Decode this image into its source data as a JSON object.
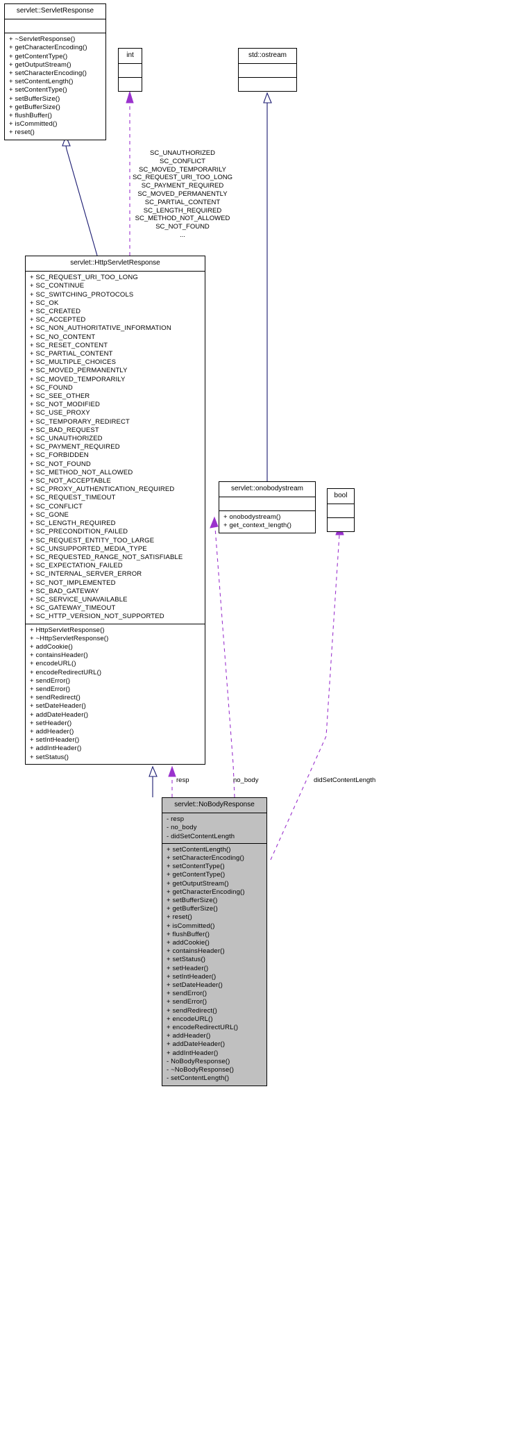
{
  "diagram": {
    "type": "uml-collaboration-diagram",
    "colors": {
      "inheritance_edge": "#191970",
      "usage_edge": "#9a32cd",
      "node_border": "#000000",
      "node_fill": "#ffffff",
      "focus_node_fill": "#c0c0c0"
    }
  },
  "nodes": {
    "servlet_response": {
      "title": "servlet::ServletResponse",
      "attributes": [],
      "operations": [
        "+ ~ServletResponse()",
        "+ getCharacterEncoding()",
        "+ getContentType()",
        "+ getOutputStream()",
        "+ setCharacterEncoding()",
        "+ setContentLength()",
        "+ setContentType()",
        "+ setBufferSize()",
        "+ getBufferSize()",
        "+ flushBuffer()",
        "+ isCommitted()",
        "+ reset()"
      ]
    },
    "int_node": {
      "title": "int",
      "attributes": [],
      "operations": []
    },
    "ostream_node": {
      "title": "std::ostream",
      "attributes": [],
      "operations": []
    },
    "http_servlet_response": {
      "title": "servlet::HttpServletResponse",
      "attributes": [
        "+ SC_REQUEST_URI_TOO_LONG",
        "+ SC_CONTINUE",
        "+ SC_SWITCHING_PROTOCOLS",
        "+ SC_OK",
        "+ SC_CREATED",
        "+ SC_ACCEPTED",
        "+ SC_NON_AUTHORITATIVE_INFORMATION",
        "+ SC_NO_CONTENT",
        "+ SC_RESET_CONTENT",
        "+ SC_PARTIAL_CONTENT",
        "+ SC_MULTIPLE_CHOICES",
        "+ SC_MOVED_PERMANENTLY",
        "+ SC_MOVED_TEMPORARILY",
        "+ SC_FOUND",
        "+ SC_SEE_OTHER",
        "+ SC_NOT_MODIFIED",
        "+ SC_USE_PROXY",
        "+ SC_TEMPORARY_REDIRECT",
        "+ SC_BAD_REQUEST",
        "+ SC_UNAUTHORIZED",
        "+ SC_PAYMENT_REQUIRED",
        "+ SC_FORBIDDEN",
        "+ SC_NOT_FOUND",
        "+ SC_METHOD_NOT_ALLOWED",
        "+ SC_NOT_ACCEPTABLE",
        "+ SC_PROXY_AUTHENTICATION_REQUIRED",
        "+ SC_REQUEST_TIMEOUT",
        "+ SC_CONFLICT",
        "+ SC_GONE",
        "+ SC_LENGTH_REQUIRED",
        "+ SC_PRECONDITION_FAILED",
        "+ SC_REQUEST_ENTITY_TOO_LARGE",
        "+ SC_UNSUPPORTED_MEDIA_TYPE",
        "+ SC_REQUESTED_RANGE_NOT_SATISFIABLE",
        "+ SC_EXPECTATION_FAILED",
        "+ SC_INTERNAL_SERVER_ERROR",
        "+ SC_NOT_IMPLEMENTED",
        "+ SC_BAD_GATEWAY",
        "+ SC_SERVICE_UNAVAILABLE",
        "+ SC_GATEWAY_TIMEOUT",
        "+ SC_HTTP_VERSION_NOT_SUPPORTED"
      ],
      "operations": [
        "+ HttpServletResponse()",
        "+ ~HttpServletResponse()",
        "+ addCookie()",
        "+ containsHeader()",
        "+ encodeURL()",
        "+ encodeRedirectURL()",
        "+ sendError()",
        "+ sendError()",
        "+ sendRedirect()",
        "+ setDateHeader()",
        "+ addDateHeader()",
        "+ setHeader()",
        "+ addHeader()",
        "+ setIntHeader()",
        "+ addIntHeader()",
        "+ setStatus()"
      ]
    },
    "onobodystream": {
      "title": "servlet::onobodystream",
      "attributes": [],
      "operations": [
        "+ onobodystream()",
        "+ get_context_length()"
      ]
    },
    "bool_node": {
      "title": "bool",
      "attributes": [],
      "operations": []
    },
    "no_body_response": {
      "title": "servlet::NoBodyResponse",
      "attributes": [
        "- resp",
        "- no_body",
        "- didSetContentLength"
      ],
      "operations": [
        "+ setContentLength()",
        "+ setCharacterEncoding()",
        "+ setContentType()",
        "+ getContentType()",
        "+ getOutputStream()",
        "+ getCharacterEncoding()",
        "+ setBufferSize()",
        "+ getBufferSize()",
        "+ reset()",
        "+ isCommitted()",
        "+ flushBuffer()",
        "+ addCookie()",
        "+ containsHeader()",
        "+ setStatus()",
        "+ setHeader()",
        "+ setIntHeader()",
        "+ setDateHeader()",
        "+ sendError()",
        "+ sendError()",
        "+ sendRedirect()",
        "+ encodeURL()",
        "+ encodeRedirectURL()",
        "+ addHeader()",
        "+ addDateHeader()",
        "+ addIntHeader()",
        "- NoBodyResponse()",
        "- ~NoBodyResponse()",
        "- setContentLength()"
      ]
    }
  },
  "edge_labels": {
    "int_to_http": "SC_UNAUTHORIZED\nSC_CONFLICT\nSC_MOVED_TEMPORARILY\nSC_REQUEST_URI_TOO_LONG\nSC_PAYMENT_REQUIRED\nSC_MOVED_PERMANENTLY\nSC_PARTIAL_CONTENT\nSC_LENGTH_REQUIRED\nSC_METHOD_NOT_ALLOWED\nSC_NOT_FOUND\n...",
    "resp": "resp",
    "no_body": "no_body",
    "did_set_content_length": "didSetContentLength"
  }
}
